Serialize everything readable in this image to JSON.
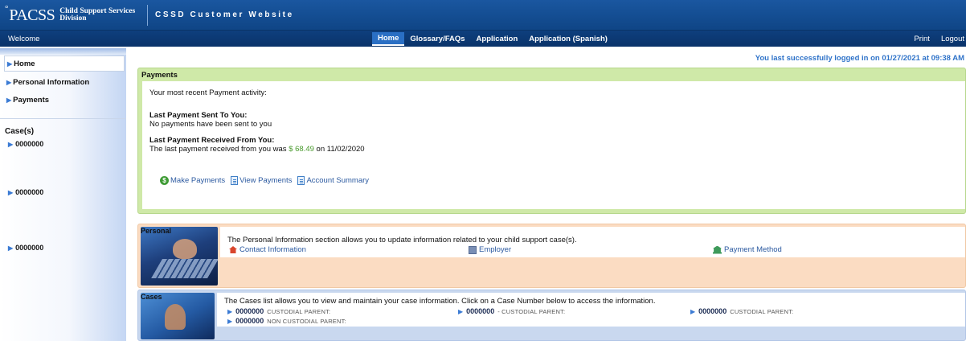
{
  "header": {
    "logo_main": "PACSS",
    "logo_line1": "Child Support Services",
    "logo_line2": "Division",
    "site_title": "CSSD Customer Website"
  },
  "navbar": {
    "welcome": "Welcome",
    "menu": [
      "Home",
      "Glossary/FAQs",
      "Application",
      "Application (Spanish)"
    ],
    "print": "Print",
    "logout": "Logout"
  },
  "sidebar": {
    "items": [
      "Home",
      "Personal Information",
      "Payments"
    ],
    "cases_heading": "Case(s)",
    "cases": [
      "0000000",
      "0000000",
      "0000000"
    ]
  },
  "last_login": "You last successfully logged in on 01/27/2021 at 09:38 AM",
  "payments": {
    "title": "Payments",
    "intro": "Your most recent Payment activity:",
    "sent_heading": "Last Payment Sent To You:",
    "sent_text": "No payments have been sent to you",
    "received_heading": "Last Payment Received From You:",
    "received_prefix": "The last payment received from you was",
    "received_amount": "$ 68.49",
    "received_suffix": "on 11/02/2020",
    "actions": [
      "Make Payments",
      "View Payments",
      "Account Summary"
    ]
  },
  "personal": {
    "tag": "Personal",
    "description": "The Personal Information section allows you to update information related to your child support case(s).",
    "links": [
      "Contact Information",
      "Employer",
      "Payment Method"
    ]
  },
  "cases_panel": {
    "tag": "Cases",
    "description": "The Cases list allows you to view and maintain your case information. Click on a Case Number below to access the information.",
    "entries": [
      {
        "number": "0000000",
        "role": "CUSTODIAL PARENT:"
      },
      {
        "number": "0000000",
        "role": "NON CUSTODIAL PARENT:"
      },
      {
        "number": "0000000",
        "role": "- CUSTODIAL PARENT:"
      },
      {
        "number": "0000000",
        "role": "CUSTODIAL PARENT:"
      }
    ]
  },
  "colors": {
    "header_blue": "#0f4586",
    "link_blue": "#2c5aa0",
    "payments_green": "#cfe9a8",
    "personal_peach": "#fbdcc2",
    "cases_blue": "#c9d8ef",
    "amount_green": "#4a9a2e"
  }
}
